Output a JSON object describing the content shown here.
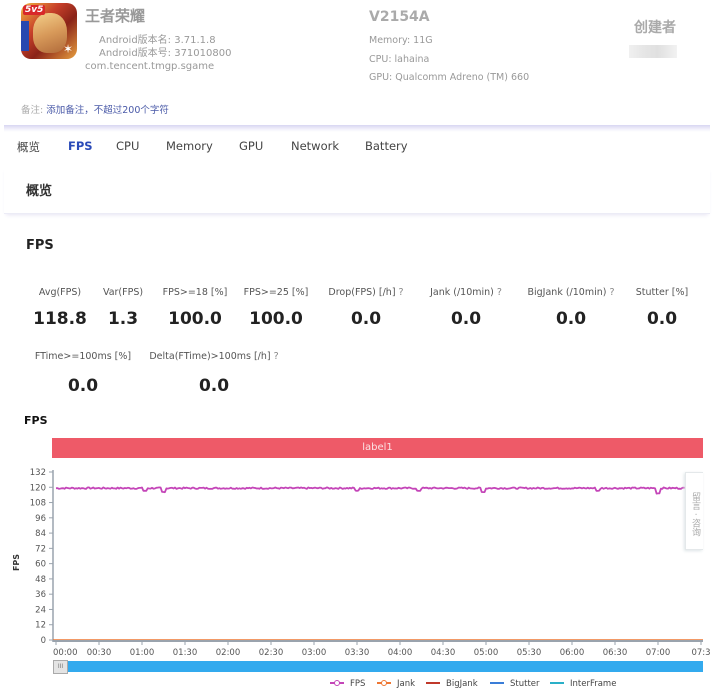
{
  "app": {
    "icon": "game-app-icon",
    "icon_badge": "5v5",
    "name": "王者荣耀",
    "version_name": "Android版本名: 3.71.1.8",
    "version_code": "Android版本号: 371010800",
    "package": "com.tencent.tmgp.sgame"
  },
  "note": {
    "label": "备注:",
    "link": "添加备注，不超过200个字符"
  },
  "device": {
    "name": "V2154A",
    "memory": "Memory: 11G",
    "cpu": "CPU: lahaina",
    "gpu": "GPU: Qualcomm Adreno (TM) 660"
  },
  "creator": {
    "title": "创建者"
  },
  "tabs": [
    {
      "label": "概览",
      "active": false
    },
    {
      "label": "FPS",
      "active": true
    },
    {
      "label": "CPU",
      "active": false
    },
    {
      "label": "Memory",
      "active": false
    },
    {
      "label": "GPU",
      "active": false
    },
    {
      "label": "Network",
      "active": false
    },
    {
      "label": "Battery",
      "active": false
    }
  ],
  "section_title": "概览",
  "fps_section": {
    "title": "FPS",
    "metrics": [
      {
        "label": "Avg(FPS)",
        "value": "118.8",
        "help": false
      },
      {
        "label": "Var(FPS)",
        "value": "1.3",
        "help": false
      },
      {
        "label": "FPS>=18 [%]",
        "value": "100.0",
        "help": false
      },
      {
        "label": "FPS>=25 [%]",
        "value": "100.0",
        "help": false
      },
      {
        "label": "Drop(FPS) [/h]",
        "value": "0.0",
        "help": true
      },
      {
        "label": "Jank (/10min)",
        "value": "0.0",
        "help": true
      },
      {
        "label": "BigJank (/10min)",
        "value": "0.0",
        "help": true
      },
      {
        "label": "Stutter [%]",
        "value": "0.0",
        "help": false
      },
      {
        "label": "FTime>=100ms [%]",
        "value": "0.0",
        "help": false
      },
      {
        "label": "Delta(FTime)>100ms [/h]",
        "value": "0.0",
        "help": true
      }
    ],
    "help_glyph": "?"
  },
  "chart_data": {
    "type": "line",
    "title": "FPS",
    "ylabel": "FPS",
    "xlabel": "",
    "ylim": [
      0,
      132
    ],
    "yticks": [
      0,
      12,
      24,
      36,
      48,
      60,
      72,
      84,
      96,
      108,
      120,
      132
    ],
    "xticks": [
      "00:00",
      "00:30",
      "01:00",
      "01:30",
      "02:00",
      "02:30",
      "03:00",
      "03:30",
      "04:00",
      "04:30",
      "05:00",
      "05:30",
      "06:00",
      "06:30",
      "07:00",
      "07:3"
    ],
    "xlim_seconds": [
      0,
      450
    ],
    "label_band": {
      "text": "label1",
      "color": "#ee5a68"
    },
    "grid": false,
    "legend_position": "bottom-center",
    "series": [
      {
        "name": "FPS",
        "color": "#c445b8",
        "marker": true,
        "approx_mean": 118.8,
        "approx_range": [
          115,
          120
        ]
      },
      {
        "name": "Jank",
        "color": "#ee7733",
        "marker": true,
        "approx_mean": 0
      },
      {
        "name": "BigJank",
        "color": "#c0392b",
        "marker": false,
        "approx_mean": 0
      },
      {
        "name": "Stutter",
        "color": "#3a7dd8",
        "marker": false,
        "approx_mean": 0
      },
      {
        "name": "InterFrame",
        "color": "#2ab0c8",
        "marker": false,
        "approx_mean": 0
      }
    ],
    "dips": [
      {
        "t": 62,
        "fps": 117
      },
      {
        "t": 75,
        "fps": 116
      },
      {
        "t": 210,
        "fps": 117
      },
      {
        "t": 253,
        "fps": 117
      },
      {
        "t": 298,
        "fps": 116
      },
      {
        "t": 378,
        "fps": 117
      },
      {
        "t": 420,
        "fps": 115
      }
    ]
  },
  "slider": {
    "handle_glyph": "III"
  },
  "feedback": {
    "label": "留言 · 咨询"
  }
}
